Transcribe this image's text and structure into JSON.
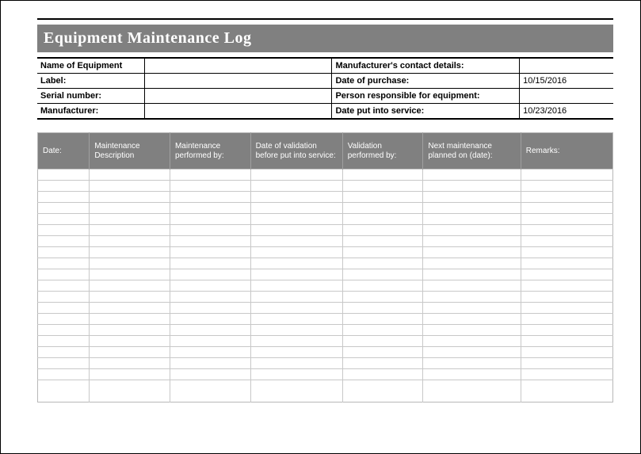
{
  "title": "Equipment Maintenance Log",
  "meta": {
    "name_of_equipment_label": "Name of Equipment",
    "name_of_equipment_value": "",
    "label_label": "Label:",
    "label_value": "",
    "serial_number_label": "Serial number:",
    "serial_number_value": "",
    "manufacturer_label": "Manufacturer:",
    "manufacturer_value": "",
    "mfr_contact_label": "Manufacturer's contact details:",
    "mfr_contact_value": "",
    "date_of_purchase_label": "Date of purchase:",
    "date_of_purchase_value": "10/15/2016",
    "person_responsible_label": "Person responsible for equipment:",
    "person_responsible_value": "",
    "date_put_into_service_label": "Date put into service:",
    "date_put_into_service_value": "10/23/2016"
  },
  "log_headers": {
    "date": "Date:",
    "description": "Maintenance Description",
    "performed_by": "Maintenance performed by:",
    "validation_date": "Date of validation before put into service:",
    "validation_by": "Validation performed by:",
    "next_planned": "Next maintenance planned on (date):",
    "remarks": "Remarks:"
  },
  "log_row_count": 20
}
